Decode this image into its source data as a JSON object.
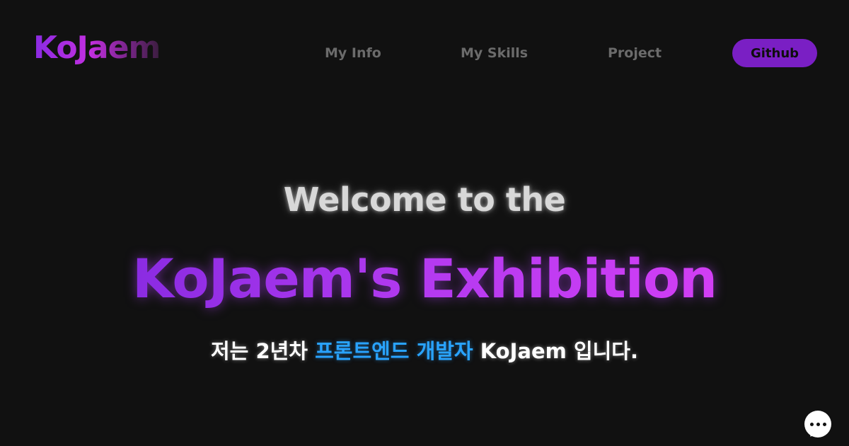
{
  "header": {
    "logo": "KoJaem",
    "nav": [
      {
        "label": "My Info"
      },
      {
        "label": "My Skills"
      },
      {
        "label": "Project"
      }
    ],
    "github_label": "Github"
  },
  "hero": {
    "line1": "Welcome to the",
    "line2": "KoJaem's Exhibition",
    "line3": {
      "prefix": "저는 2년차 ",
      "highlight": "프론트엔드 개발자",
      "suffix": " KoJaem 입니다."
    }
  },
  "chat_widget": {
    "icon": "chat-bubble-icon"
  },
  "colors": {
    "background": "#111111",
    "accent_purple": "#8a2be2",
    "accent_magenta": "#d23ef5",
    "github_button": "#7a1fc4",
    "highlight_blue": "#29a3ff",
    "nav_text": "#6b6b6b"
  }
}
